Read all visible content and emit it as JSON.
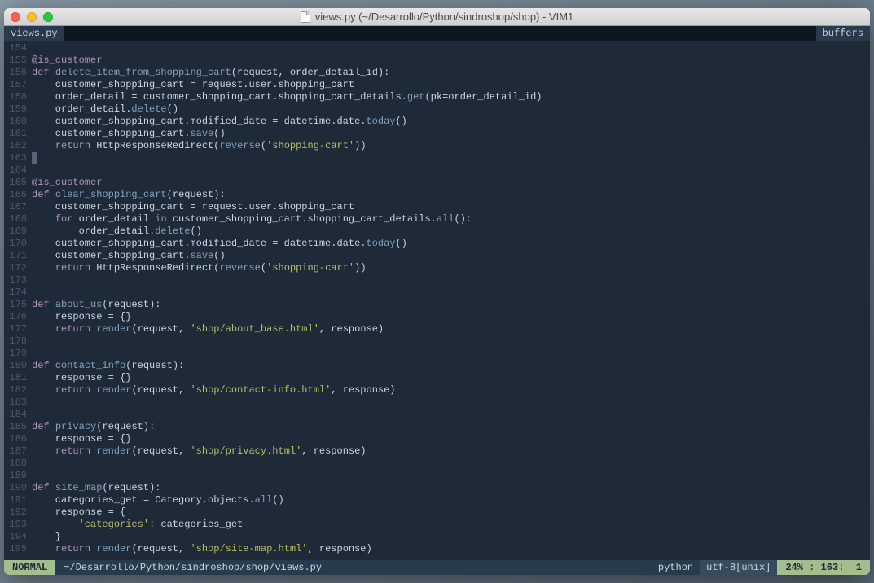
{
  "window": {
    "title": "views.py (~/Desarrollo/Python/sindroshop/shop) - VIM1"
  },
  "tabline": {
    "active_tab": "views.py",
    "right": "buffers"
  },
  "gutter": {
    "start": 154,
    "end": 195
  },
  "code_lines": [
    [],
    [
      {
        "c": "k-dec",
        "t": "@is_customer"
      }
    ],
    [
      {
        "c": "k-kw",
        "t": "def "
      },
      {
        "c": "k-fn",
        "t": "delete_item_from_shopping_cart"
      },
      {
        "c": "k-id",
        "t": "(request, order_detail_id):"
      }
    ],
    [
      {
        "c": "k-id",
        "t": "    customer_shopping_cart = request.user.shopping_cart"
      }
    ],
    [
      {
        "c": "k-id",
        "t": "    order_detail = customer_shopping_cart.shopping_cart_details."
      },
      {
        "c": "k-call",
        "t": "get"
      },
      {
        "c": "k-id",
        "t": "(pk=order_detail_id)"
      }
    ],
    [
      {
        "c": "k-id",
        "t": "    order_detail."
      },
      {
        "c": "k-call",
        "t": "delete"
      },
      {
        "c": "k-id",
        "t": "()"
      }
    ],
    [
      {
        "c": "k-id",
        "t": "    customer_shopping_cart.modified_date = datetime.date."
      },
      {
        "c": "k-call",
        "t": "today"
      },
      {
        "c": "k-id",
        "t": "()"
      }
    ],
    [
      {
        "c": "k-id",
        "t": "    customer_shopping_cart."
      },
      {
        "c": "k-call",
        "t": "save"
      },
      {
        "c": "k-id",
        "t": "()"
      }
    ],
    [
      {
        "c": "k-id",
        "t": "    "
      },
      {
        "c": "k-kw",
        "t": "return"
      },
      {
        "c": "k-id",
        "t": " HttpResponseRedirect("
      },
      {
        "c": "k-call",
        "t": "reverse"
      },
      {
        "c": "k-id",
        "t": "("
      },
      {
        "c": "k-str",
        "t": "'shopping-cart'"
      },
      {
        "c": "k-id",
        "t": "))"
      }
    ],
    [
      {
        "cursor": true
      }
    ],
    [],
    [
      {
        "c": "k-dec",
        "t": "@is_customer"
      }
    ],
    [
      {
        "c": "k-kw",
        "t": "def "
      },
      {
        "c": "k-fn",
        "t": "clear_shopping_cart"
      },
      {
        "c": "k-id",
        "t": "(request):"
      }
    ],
    [
      {
        "c": "k-id",
        "t": "    customer_shopping_cart = request.user.shopping_cart"
      }
    ],
    [
      {
        "c": "k-id",
        "t": "    "
      },
      {
        "c": "k-kw",
        "t": "for"
      },
      {
        "c": "k-id",
        "t": " order_detail "
      },
      {
        "c": "k-kw",
        "t": "in"
      },
      {
        "c": "k-id",
        "t": " customer_shopping_cart.shopping_cart_details."
      },
      {
        "c": "k-call",
        "t": "all"
      },
      {
        "c": "k-id",
        "t": "():"
      }
    ],
    [
      {
        "c": "k-id",
        "t": "        order_detail."
      },
      {
        "c": "k-call",
        "t": "delete"
      },
      {
        "c": "k-id",
        "t": "()"
      }
    ],
    [
      {
        "c": "k-id",
        "t": "    customer_shopping_cart.modified_date = datetime.date."
      },
      {
        "c": "k-call",
        "t": "today"
      },
      {
        "c": "k-id",
        "t": "()"
      }
    ],
    [
      {
        "c": "k-id",
        "t": "    customer_shopping_cart."
      },
      {
        "c": "k-call",
        "t": "save"
      },
      {
        "c": "k-id",
        "t": "()"
      }
    ],
    [
      {
        "c": "k-id",
        "t": "    "
      },
      {
        "c": "k-kw",
        "t": "return"
      },
      {
        "c": "k-id",
        "t": " HttpResponseRedirect("
      },
      {
        "c": "k-call",
        "t": "reverse"
      },
      {
        "c": "k-id",
        "t": "("
      },
      {
        "c": "k-str",
        "t": "'shopping-cart'"
      },
      {
        "c": "k-id",
        "t": "))"
      }
    ],
    [],
    [],
    [
      {
        "c": "k-kw",
        "t": "def "
      },
      {
        "c": "k-fn",
        "t": "about_us"
      },
      {
        "c": "k-id",
        "t": "(request):"
      }
    ],
    [
      {
        "c": "k-id",
        "t": "    response = {}"
      }
    ],
    [
      {
        "c": "k-id",
        "t": "    "
      },
      {
        "c": "k-kw",
        "t": "return"
      },
      {
        "c": "k-id",
        "t": " "
      },
      {
        "c": "k-call",
        "t": "render"
      },
      {
        "c": "k-id",
        "t": "(request, "
      },
      {
        "c": "k-str",
        "t": "'shop/about_base.html'"
      },
      {
        "c": "k-id",
        "t": ", response)"
      }
    ],
    [],
    [],
    [
      {
        "c": "k-kw",
        "t": "def "
      },
      {
        "c": "k-fn",
        "t": "contact_info"
      },
      {
        "c": "k-id",
        "t": "(request):"
      }
    ],
    [
      {
        "c": "k-id",
        "t": "    response = {}"
      }
    ],
    [
      {
        "c": "k-id",
        "t": "    "
      },
      {
        "c": "k-kw",
        "t": "return"
      },
      {
        "c": "k-id",
        "t": " "
      },
      {
        "c": "k-call",
        "t": "render"
      },
      {
        "c": "k-id",
        "t": "(request, "
      },
      {
        "c": "k-str",
        "t": "'shop/contact-info.html'"
      },
      {
        "c": "k-id",
        "t": ", response)"
      }
    ],
    [],
    [],
    [
      {
        "c": "k-kw",
        "t": "def "
      },
      {
        "c": "k-fn",
        "t": "privacy"
      },
      {
        "c": "k-id",
        "t": "(request):"
      }
    ],
    [
      {
        "c": "k-id",
        "t": "    response = {}"
      }
    ],
    [
      {
        "c": "k-id",
        "t": "    "
      },
      {
        "c": "k-kw",
        "t": "return"
      },
      {
        "c": "k-id",
        "t": " "
      },
      {
        "c": "k-call",
        "t": "render"
      },
      {
        "c": "k-id",
        "t": "(request, "
      },
      {
        "c": "k-str",
        "t": "'shop/privacy.html'"
      },
      {
        "c": "k-id",
        "t": ", response)"
      }
    ],
    [],
    [],
    [
      {
        "c": "k-kw",
        "t": "def "
      },
      {
        "c": "k-fn",
        "t": "site_map"
      },
      {
        "c": "k-id",
        "t": "(request):"
      }
    ],
    [
      {
        "c": "k-id",
        "t": "    categories_get = Category.objects."
      },
      {
        "c": "k-call",
        "t": "all"
      },
      {
        "c": "k-id",
        "t": "()"
      }
    ],
    [
      {
        "c": "k-id",
        "t": "    response = {"
      }
    ],
    [
      {
        "c": "k-id",
        "t": "        "
      },
      {
        "c": "k-str",
        "t": "'categories'"
      },
      {
        "c": "k-id",
        "t": ": categories_get"
      }
    ],
    [
      {
        "c": "k-id",
        "t": "    }"
      }
    ],
    [
      {
        "c": "k-id",
        "t": "    "
      },
      {
        "c": "k-kw",
        "t": "return"
      },
      {
        "c": "k-id",
        "t": " "
      },
      {
        "c": "k-call",
        "t": "render"
      },
      {
        "c": "k-id",
        "t": "(request, "
      },
      {
        "c": "k-str",
        "t": "'shop/site-map.html'"
      },
      {
        "c": "k-id",
        "t": ", response)"
      }
    ]
  ],
  "statusline": {
    "mode": "NORMAL",
    "path": "~/Desarrollo/Python/sindroshop/shop/views.py",
    "filetype": "python",
    "encoding": "utf-8[unix]",
    "percent": "24%",
    "line": "163",
    "col": "1"
  }
}
